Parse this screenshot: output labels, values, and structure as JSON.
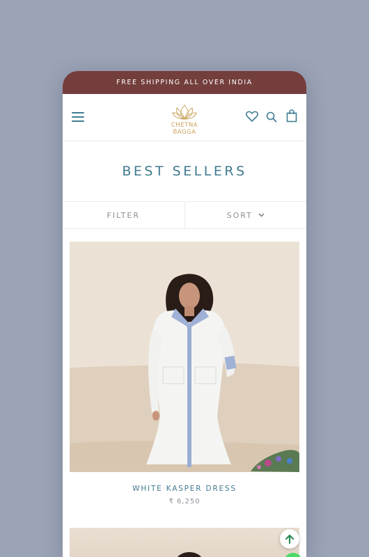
{
  "announcement": "FREE SHIPPING ALL OVER INDIA",
  "brand": {
    "logo_text": "CHETNA BAGGA"
  },
  "header": {
    "icons": [
      "menu-icon",
      "heart-icon",
      "search-icon",
      "bag-icon"
    ]
  },
  "page": {
    "title": "BEST SELLERS"
  },
  "toolbar": {
    "filter_label": "FILTER",
    "sort_label": "SORT"
  },
  "products": [
    {
      "name": "WHITE KASPER DRESS",
      "price": "₹ 6,250"
    }
  ],
  "colors": {
    "background": "#9ba3b6",
    "announcement_bar": "#733e3c",
    "accent": "#3f7a8e",
    "logo_gold": "#c9a25c"
  }
}
